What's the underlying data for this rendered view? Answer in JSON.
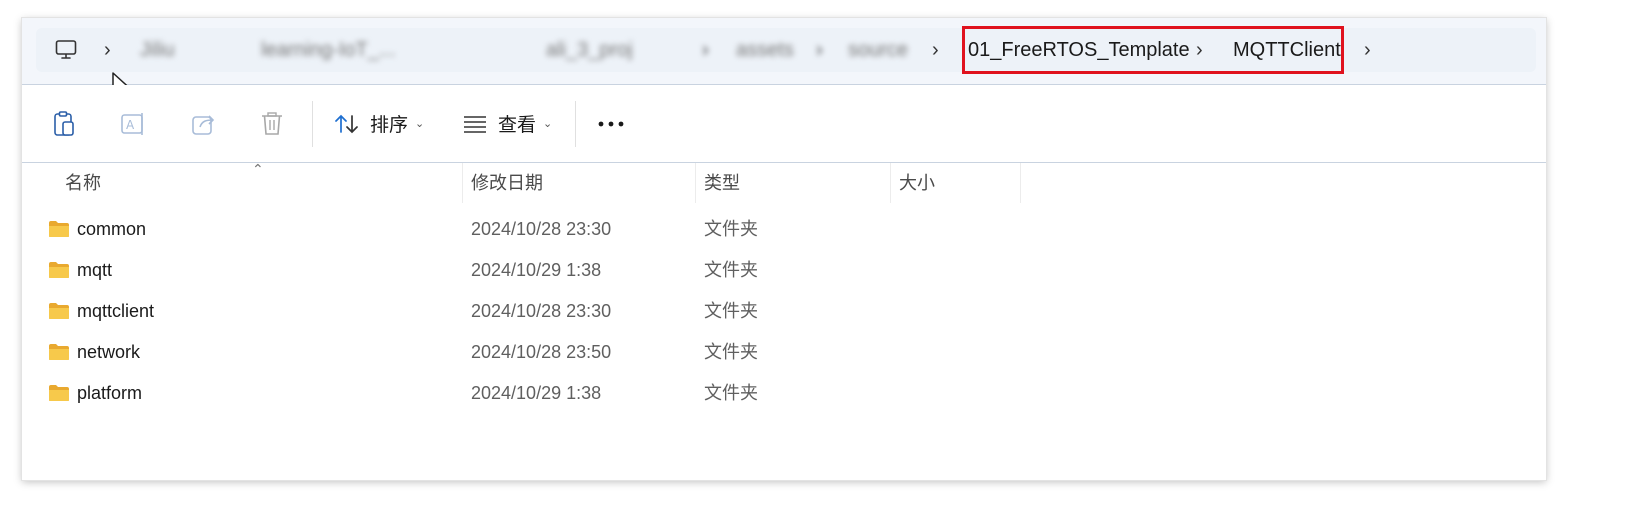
{
  "breadcrumb": {
    "items": [
      {
        "label": "Jiliu"
      },
      {
        "label": "learning-IoT_..."
      },
      {
        "label": "ali_3_proj"
      },
      {
        "label": "assets"
      },
      {
        "label": "source"
      },
      {
        "label": "01_FreeRTOS_Template"
      },
      {
        "label": "MQTTClient"
      }
    ]
  },
  "toolbar": {
    "sort_label": "排序",
    "view_label": "查看"
  },
  "columns": {
    "name": "名称",
    "modified": "修改日期",
    "type": "类型",
    "size": "大小"
  },
  "files": [
    {
      "name": "common",
      "modified": "2024/10/28 23:30",
      "type": "文件夹"
    },
    {
      "name": "mqtt",
      "modified": "2024/10/29 1:38",
      "type": "文件夹"
    },
    {
      "name": "mqttclient",
      "modified": "2024/10/28 23:30",
      "type": "文件夹"
    },
    {
      "name": "network",
      "modified": "2024/10/28 23:50",
      "type": "文件夹"
    },
    {
      "name": "platform",
      "modified": "2024/10/29 1:38",
      "type": "文件夹"
    }
  ],
  "colors": {
    "highlight": "#e0121e",
    "folder": "#f5c342",
    "accent": "#1e6fd0"
  }
}
